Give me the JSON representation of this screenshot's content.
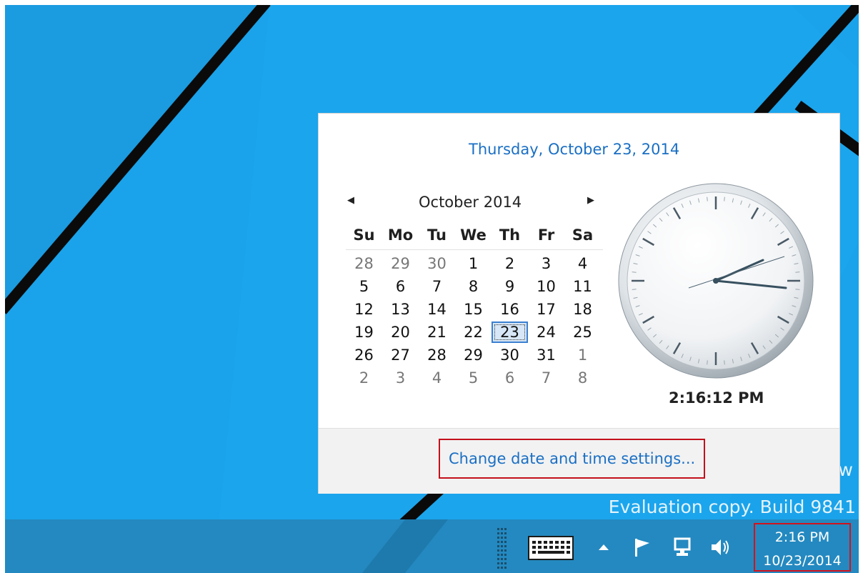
{
  "desktop": {
    "watermark_trail": "w",
    "watermark_build": "Evaluation copy. Build 9841"
  },
  "flyout": {
    "long_date": "Thursday, October 23, 2014",
    "month_title": "October 2014",
    "prev_icon": "left-arrow-icon",
    "next_icon": "right-arrow-icon",
    "days_of_week": [
      "Su",
      "Mo",
      "Tu",
      "We",
      "Th",
      "Fr",
      "Sa"
    ],
    "weeks": [
      [
        {
          "d": "28",
          "other": true
        },
        {
          "d": "29",
          "other": true
        },
        {
          "d": "30",
          "other": true
        },
        {
          "d": "1"
        },
        {
          "d": "2"
        },
        {
          "d": "3"
        },
        {
          "d": "4"
        }
      ],
      [
        {
          "d": "5"
        },
        {
          "d": "6"
        },
        {
          "d": "7"
        },
        {
          "d": "8"
        },
        {
          "d": "9"
        },
        {
          "d": "10"
        },
        {
          "d": "11"
        }
      ],
      [
        {
          "d": "12"
        },
        {
          "d": "13"
        },
        {
          "d": "14"
        },
        {
          "d": "15"
        },
        {
          "d": "16"
        },
        {
          "d": "17"
        },
        {
          "d": "18"
        }
      ],
      [
        {
          "d": "19"
        },
        {
          "d": "20"
        },
        {
          "d": "21"
        },
        {
          "d": "22"
        },
        {
          "d": "23",
          "today": true
        },
        {
          "d": "24"
        },
        {
          "d": "25"
        }
      ],
      [
        {
          "d": "26"
        },
        {
          "d": "27"
        },
        {
          "d": "28"
        },
        {
          "d": "29"
        },
        {
          "d": "30"
        },
        {
          "d": "31"
        },
        {
          "d": "1",
          "other": true
        }
      ],
      [
        {
          "d": "2",
          "other": true
        },
        {
          "d": "3",
          "other": true
        },
        {
          "d": "4",
          "other": true
        },
        {
          "d": "5",
          "other": true
        },
        {
          "d": "6",
          "other": true
        },
        {
          "d": "7",
          "other": true
        },
        {
          "d": "8",
          "other": true
        }
      ]
    ],
    "clock_time": "2:16:12 PM",
    "change_settings_link": "Change date and time settings..."
  },
  "taskbar": {
    "icons": [
      "keyboard-icon",
      "show-hidden-icons-chevron-icon",
      "action-center-flag-icon",
      "network-icon",
      "volume-icon"
    ],
    "tray_time": "2:16 PM",
    "tray_date": "10/23/2014"
  },
  "colors": {
    "desktop_blue": "#1aa3ea",
    "taskbar_blue": "#2489c0",
    "link_blue": "#1a6fc4",
    "highlight_red": "#c4101b"
  }
}
